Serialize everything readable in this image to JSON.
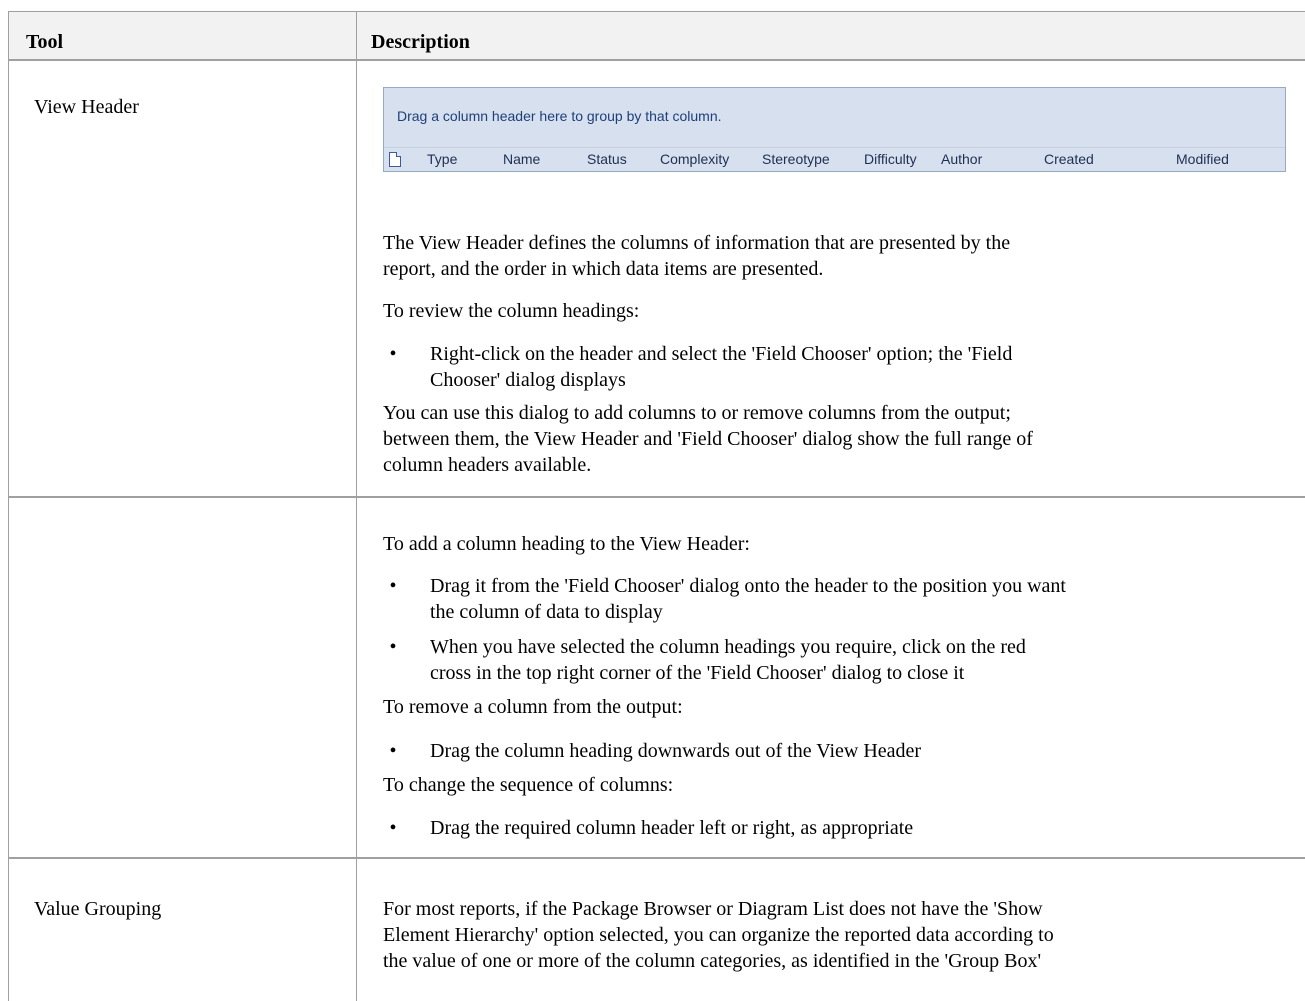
{
  "header": {
    "tool": "Tool",
    "description": "Description"
  },
  "rows": [
    {
      "tool": "View Header",
      "screenshot": {
        "drag_text": "Drag a column header here to group by that column.",
        "columns": [
          "Type",
          "Name",
          "Status",
          "Complexity",
          "Stereotype",
          "Difficulty",
          "Author",
          "Created",
          "Modified"
        ]
      },
      "p1": "The View Header defines the columns of information that are presented by the",
      "p1b": "report, and the order in which data items are presented.",
      "p2": "To review the column headings:",
      "b1a": "Right-click on the header and select the 'Field Chooser' option; the 'Field",
      "b1b": "Chooser' dialog displays",
      "p3a": "You can use this dialog to add columns to or remove columns from the output;",
      "p3b": "between them, the View Header and 'Field Chooser' dialog show the full range of",
      "p3c": "column headers available.",
      "p4": "To add a column heading to the View Header:",
      "b2a": "Drag it from the 'Field Chooser' dialog onto the header to the position you want",
      "b2b": "the column of data to display",
      "b3a": "When you have selected the column headings you require, click on the red",
      "b3b": "cross in the top right corner of the 'Field Chooser' dialog to close it",
      "p5": "To remove a column from the output:",
      "b4": "Drag the column heading downwards out of the View Header",
      "p6": "To change the sequence of columns:",
      "b5": "Drag the required column header left or right, as appropriate"
    },
    {
      "tool": "Value Grouping",
      "p1a": "For most reports, if the Package Browser or Diagram List does not have the 'Show",
      "p1b": "Element Hierarchy' option selected, you can organize the reported data according to",
      "p1c": "the value of one or more of the column categories, as identified in the 'Group Box'"
    }
  ],
  "bullet_char": "•"
}
